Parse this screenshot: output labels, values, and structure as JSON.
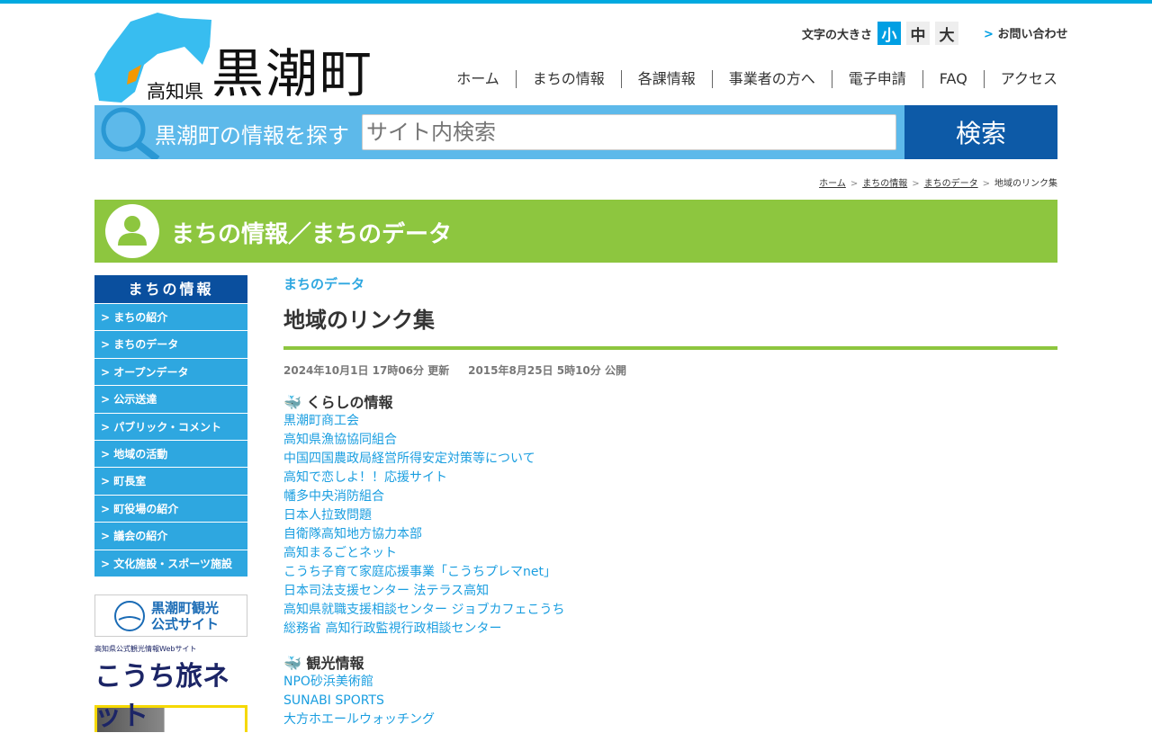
{
  "header": {
    "pref": "高知県",
    "town": "黒潮町",
    "fontsize_label": "文字の大きさ",
    "fontsizes": [
      "小",
      "中",
      "大"
    ],
    "contact": "お問い合わせ"
  },
  "nav": [
    "ホーム",
    "まちの情報",
    "各課情報",
    "事業者の方へ",
    "電子申請",
    "FAQ",
    "アクセス"
  ],
  "search": {
    "label": "黒潮町の情報を探す",
    "placeholder": "サイト内検索",
    "button": "検索"
  },
  "breadcrumb": [
    "ホーム",
    "まちの情報",
    "まちのデータ",
    "地域のリンク集"
  ],
  "banner_title": "まちの情報／まちのデータ",
  "sidebar": {
    "heading": "まちの情報",
    "items": [
      "まちの紹介",
      "まちのデータ",
      "オープンデータ",
      "公示送達",
      "パブリック・コメント",
      "地域の活動",
      "町長室",
      "町役場の紹介",
      "議会の紹介",
      "文化施設・スポーツ施設"
    ]
  },
  "side_banners": {
    "kankou": "黒潮町観光 公式サイト",
    "tabi_sub": "高知県公式観光情報Webサイト",
    "tabi": "こうち旅ネット"
  },
  "main": {
    "category": "まちのデータ",
    "title": "地域のリンク集",
    "updated": "2024年10月1日 17時06分 更新",
    "published": "2015年8月25日 5時10分 公開",
    "sections": [
      {
        "heading": "くらしの情報",
        "links": [
          "黒潮町商工会",
          "高知県漁協協同組合",
          "中国四国農政局経営所得安定対策等について",
          "高知で恋しよ！！応援サイト",
          "幡多中央消防組合",
          "日本人拉致問題",
          "自衛隊高知地方協力本部",
          "高知まるごとネット",
          "こうち子育て家庭応援事業「こうちプレマnet」",
          "日本司法支援センター 法テラス高知",
          "高知県就職支援相談センター ジョブカフェこうち",
          "総務省 高知行政監視行政相談センター"
        ]
      },
      {
        "heading": "観光情報",
        "links": [
          "NPO砂浜美術館",
          "SUNABI SPORTS",
          "大方ホエールウォッチング"
        ]
      }
    ]
  }
}
